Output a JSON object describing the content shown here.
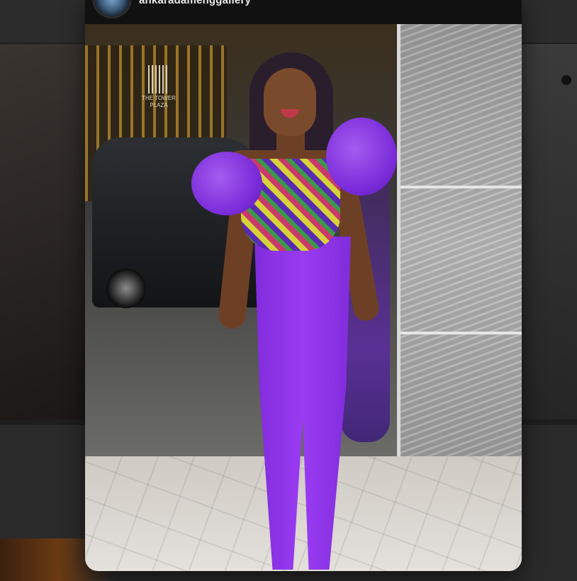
{
  "post": {
    "account_name": "ankaradamenggallery",
    "image_alt": "Woman in purple jumpsuit with patterned bodice",
    "sign_text": "THE TOWER PLAZA"
  },
  "icons": {
    "avatar": "account-avatar",
    "visual_search": "visual-search-icon"
  },
  "colors": {
    "accent_purple": "#8a2be2",
    "modal_bg": "#0f0f0f",
    "button_bg": "#ffffff"
  }
}
